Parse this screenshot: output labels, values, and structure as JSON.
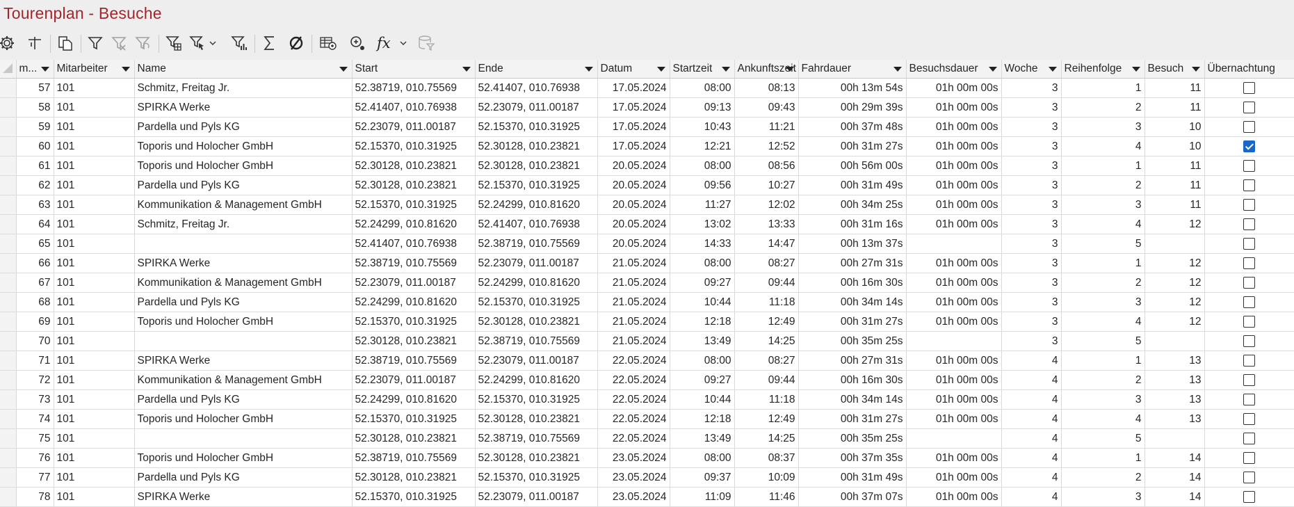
{
  "window": {
    "title": "Tourenplan - Besuche"
  },
  "toolbar": {
    "icons": [
      "gear-icon",
      "field-chooser-icon",
      "copy-icon",
      "filter-icon",
      "clear-filter-icon",
      "undo-filter-icon",
      "filter-grid-icon",
      "filter-cursor-icon",
      "filter-dropdown-icon",
      "filter-chart-icon",
      "sum-icon",
      "empty-set-icon",
      "table-settings-icon",
      "add-zoom-icon",
      "formula-icon",
      "formula-dropdown-icon",
      "database-filter-icon"
    ]
  },
  "columns": [
    {
      "key": "nr",
      "label": "m..."
    },
    {
      "key": "mitarbeiter",
      "label": "Mitarbeiter"
    },
    {
      "key": "name",
      "label": "Name"
    },
    {
      "key": "start",
      "label": "Start"
    },
    {
      "key": "ende",
      "label": "Ende"
    },
    {
      "key": "datum",
      "label": "Datum"
    },
    {
      "key": "startzeit",
      "label": "Startzeit"
    },
    {
      "key": "ankunft",
      "label": "Ankunftszeit"
    },
    {
      "key": "fahrdauer",
      "label": "Fahrdauer"
    },
    {
      "key": "besuchsdauer",
      "label": "Besuchsdauer"
    },
    {
      "key": "woche",
      "label": "Woche"
    },
    {
      "key": "reihenfolge",
      "label": "Reihenfolge"
    },
    {
      "key": "besuch",
      "label": "Besuch"
    },
    {
      "key": "uebernachtung",
      "label": "Übernachtung"
    }
  ],
  "rows": [
    {
      "nr": "57",
      "mitarbeiter": "101",
      "name": "Schmitz, Freitag Jr.",
      "start": "52.38719, 010.75569",
      "ende": "52.41407, 010.76938",
      "datum": "17.05.2024",
      "startzeit": "08:00",
      "ankunft": "08:13",
      "fahrdauer": "00h 13m 54s",
      "besuchsdauer": "01h 00m 00s",
      "woche": "3",
      "reihenfolge": "1",
      "besuch": "11",
      "uebernachtung": false
    },
    {
      "nr": "58",
      "mitarbeiter": "101",
      "name": "SPIRKA Werke",
      "start": "52.41407, 010.76938",
      "ende": "52.23079, 011.00187",
      "datum": "17.05.2024",
      "startzeit": "09:13",
      "ankunft": "09:43",
      "fahrdauer": "00h 29m 39s",
      "besuchsdauer": "01h 00m 00s",
      "woche": "3",
      "reihenfolge": "2",
      "besuch": "11",
      "uebernachtung": false
    },
    {
      "nr": "59",
      "mitarbeiter": "101",
      "name": "Pardella und Pyls KG",
      "start": "52.23079, 011.00187",
      "ende": "52.15370, 010.31925",
      "datum": "17.05.2024",
      "startzeit": "10:43",
      "ankunft": "11:21",
      "fahrdauer": "00h 37m 48s",
      "besuchsdauer": "01h 00m 00s",
      "woche": "3",
      "reihenfolge": "3",
      "besuch": "10",
      "uebernachtung": false
    },
    {
      "nr": "60",
      "mitarbeiter": "101",
      "name": "Toporis und Holocher GmbH",
      "start": "52.15370, 010.31925",
      "ende": "52.30128, 010.23821",
      "datum": "17.05.2024",
      "startzeit": "12:21",
      "ankunft": "12:52",
      "fahrdauer": "00h 31m 27s",
      "besuchsdauer": "01h 00m 00s",
      "woche": "3",
      "reihenfolge": "4",
      "besuch": "10",
      "uebernachtung": true
    },
    {
      "nr": "61",
      "mitarbeiter": "101",
      "name": "Toporis und Holocher GmbH",
      "start": "52.30128, 010.23821",
      "ende": "52.30128, 010.23821",
      "datum": "20.05.2024",
      "startzeit": "08:00",
      "ankunft": "08:56",
      "fahrdauer": "00h 56m 00s",
      "besuchsdauer": "01h 00m 00s",
      "woche": "3",
      "reihenfolge": "1",
      "besuch": "11",
      "uebernachtung": false
    },
    {
      "nr": "62",
      "mitarbeiter": "101",
      "name": "Pardella und Pyls KG",
      "start": "52.30128, 010.23821",
      "ende": "52.15370, 010.31925",
      "datum": "20.05.2024",
      "startzeit": "09:56",
      "ankunft": "10:27",
      "fahrdauer": "00h 31m 49s",
      "besuchsdauer": "01h 00m 00s",
      "woche": "3",
      "reihenfolge": "2",
      "besuch": "11",
      "uebernachtung": false
    },
    {
      "nr": "63",
      "mitarbeiter": "101",
      "name": "Kommunikation & Management GmbH",
      "start": "52.15370, 010.31925",
      "ende": "52.24299, 010.81620",
      "datum": "20.05.2024",
      "startzeit": "11:27",
      "ankunft": "12:02",
      "fahrdauer": "00h 34m 25s",
      "besuchsdauer": "01h 00m 00s",
      "woche": "3",
      "reihenfolge": "3",
      "besuch": "11",
      "uebernachtung": false
    },
    {
      "nr": "64",
      "mitarbeiter": "101",
      "name": "Schmitz, Freitag Jr.",
      "start": "52.24299, 010.81620",
      "ende": "52.41407, 010.76938",
      "datum": "20.05.2024",
      "startzeit": "13:02",
      "ankunft": "13:33",
      "fahrdauer": "00h 31m 16s",
      "besuchsdauer": "01h 00m 00s",
      "woche": "3",
      "reihenfolge": "4",
      "besuch": "12",
      "uebernachtung": false
    },
    {
      "nr": "65",
      "mitarbeiter": "101",
      "name": "",
      "start": "52.41407, 010.76938",
      "ende": "52.38719, 010.75569",
      "datum": "20.05.2024",
      "startzeit": "14:33",
      "ankunft": "14:47",
      "fahrdauer": "00h 13m 37s",
      "besuchsdauer": "",
      "woche": "3",
      "reihenfolge": "5",
      "besuch": "",
      "uebernachtung": false
    },
    {
      "nr": "66",
      "mitarbeiter": "101",
      "name": "SPIRKA Werke",
      "start": "52.38719, 010.75569",
      "ende": "52.23079, 011.00187",
      "datum": "21.05.2024",
      "startzeit": "08:00",
      "ankunft": "08:27",
      "fahrdauer": "00h 27m 31s",
      "besuchsdauer": "01h 00m 00s",
      "woche": "3",
      "reihenfolge": "1",
      "besuch": "12",
      "uebernachtung": false
    },
    {
      "nr": "67",
      "mitarbeiter": "101",
      "name": "Kommunikation & Management GmbH",
      "start": "52.23079, 011.00187",
      "ende": "52.24299, 010.81620",
      "datum": "21.05.2024",
      "startzeit": "09:27",
      "ankunft": "09:44",
      "fahrdauer": "00h 16m 30s",
      "besuchsdauer": "01h 00m 00s",
      "woche": "3",
      "reihenfolge": "2",
      "besuch": "12",
      "uebernachtung": false
    },
    {
      "nr": "68",
      "mitarbeiter": "101",
      "name": "Pardella und Pyls KG",
      "start": "52.24299, 010.81620",
      "ende": "52.15370, 010.31925",
      "datum": "21.05.2024",
      "startzeit": "10:44",
      "ankunft": "11:18",
      "fahrdauer": "00h 34m 14s",
      "besuchsdauer": "01h 00m 00s",
      "woche": "3",
      "reihenfolge": "3",
      "besuch": "12",
      "uebernachtung": false
    },
    {
      "nr": "69",
      "mitarbeiter": "101",
      "name": "Toporis und Holocher GmbH",
      "start": "52.15370, 010.31925",
      "ende": "52.30128, 010.23821",
      "datum": "21.05.2024",
      "startzeit": "12:18",
      "ankunft": "12:49",
      "fahrdauer": "00h 31m 27s",
      "besuchsdauer": "01h 00m 00s",
      "woche": "3",
      "reihenfolge": "4",
      "besuch": "12",
      "uebernachtung": false
    },
    {
      "nr": "70",
      "mitarbeiter": "101",
      "name": "",
      "start": "52.30128, 010.23821",
      "ende": "52.38719, 010.75569",
      "datum": "21.05.2024",
      "startzeit": "13:49",
      "ankunft": "14:25",
      "fahrdauer": "00h 35m 25s",
      "besuchsdauer": "",
      "woche": "3",
      "reihenfolge": "5",
      "besuch": "",
      "uebernachtung": false
    },
    {
      "nr": "71",
      "mitarbeiter": "101",
      "name": "SPIRKA Werke",
      "start": "52.38719, 010.75569",
      "ende": "52.23079, 011.00187",
      "datum": "22.05.2024",
      "startzeit": "08:00",
      "ankunft": "08:27",
      "fahrdauer": "00h 27m 31s",
      "besuchsdauer": "01h 00m 00s",
      "woche": "4",
      "reihenfolge": "1",
      "besuch": "13",
      "uebernachtung": false
    },
    {
      "nr": "72",
      "mitarbeiter": "101",
      "name": "Kommunikation & Management GmbH",
      "start": "52.23079, 011.00187",
      "ende": "52.24299, 010.81620",
      "datum": "22.05.2024",
      "startzeit": "09:27",
      "ankunft": "09:44",
      "fahrdauer": "00h 16m 30s",
      "besuchsdauer": "01h 00m 00s",
      "woche": "4",
      "reihenfolge": "2",
      "besuch": "13",
      "uebernachtung": false
    },
    {
      "nr": "73",
      "mitarbeiter": "101",
      "name": "Pardella und Pyls KG",
      "start": "52.24299, 010.81620",
      "ende": "52.15370, 010.31925",
      "datum": "22.05.2024",
      "startzeit": "10:44",
      "ankunft": "11:18",
      "fahrdauer": "00h 34m 14s",
      "besuchsdauer": "01h 00m 00s",
      "woche": "4",
      "reihenfolge": "3",
      "besuch": "13",
      "uebernachtung": false
    },
    {
      "nr": "74",
      "mitarbeiter": "101",
      "name": "Toporis und Holocher GmbH",
      "start": "52.15370, 010.31925",
      "ende": "52.30128, 010.23821",
      "datum": "22.05.2024",
      "startzeit": "12:18",
      "ankunft": "12:49",
      "fahrdauer": "00h 31m 27s",
      "besuchsdauer": "01h 00m 00s",
      "woche": "4",
      "reihenfolge": "4",
      "besuch": "13",
      "uebernachtung": false
    },
    {
      "nr": "75",
      "mitarbeiter": "101",
      "name": "",
      "start": "52.30128, 010.23821",
      "ende": "52.38719, 010.75569",
      "datum": "22.05.2024",
      "startzeit": "13:49",
      "ankunft": "14:25",
      "fahrdauer": "00h 35m 25s",
      "besuchsdauer": "",
      "woche": "4",
      "reihenfolge": "5",
      "besuch": "",
      "uebernachtung": false
    },
    {
      "nr": "76",
      "mitarbeiter": "101",
      "name": "Toporis und Holocher GmbH",
      "start": "52.38719, 010.75569",
      "ende": "52.30128, 010.23821",
      "datum": "23.05.2024",
      "startzeit": "08:00",
      "ankunft": "08:37",
      "fahrdauer": "00h 37m 35s",
      "besuchsdauer": "01h 00m 00s",
      "woche": "4",
      "reihenfolge": "1",
      "besuch": "14",
      "uebernachtung": false
    },
    {
      "nr": "77",
      "mitarbeiter": "101",
      "name": "Pardella und Pyls KG",
      "start": "52.30128, 010.23821",
      "ende": "52.15370, 010.31925",
      "datum": "23.05.2024",
      "startzeit": "09:37",
      "ankunft": "10:09",
      "fahrdauer": "00h 31m 49s",
      "besuchsdauer": "01h 00m 00s",
      "woche": "4",
      "reihenfolge": "2",
      "besuch": "14",
      "uebernachtung": false
    },
    {
      "nr": "78",
      "mitarbeiter": "101",
      "name": "SPIRKA Werke",
      "start": "52.15370, 010.31925",
      "ende": "52.23079, 011.00187",
      "datum": "23.05.2024",
      "startzeit": "11:09",
      "ankunft": "11:46",
      "fahrdauer": "00h 37m 07s",
      "besuchsdauer": "01h 00m 00s",
      "woche": "4",
      "reihenfolge": "3",
      "besuch": "14",
      "uebernachtung": false
    }
  ],
  "colors": {
    "title": "#a4262c",
    "checkbox_checked": "#1a66c8",
    "header_bg": "#f3f3f3"
  }
}
